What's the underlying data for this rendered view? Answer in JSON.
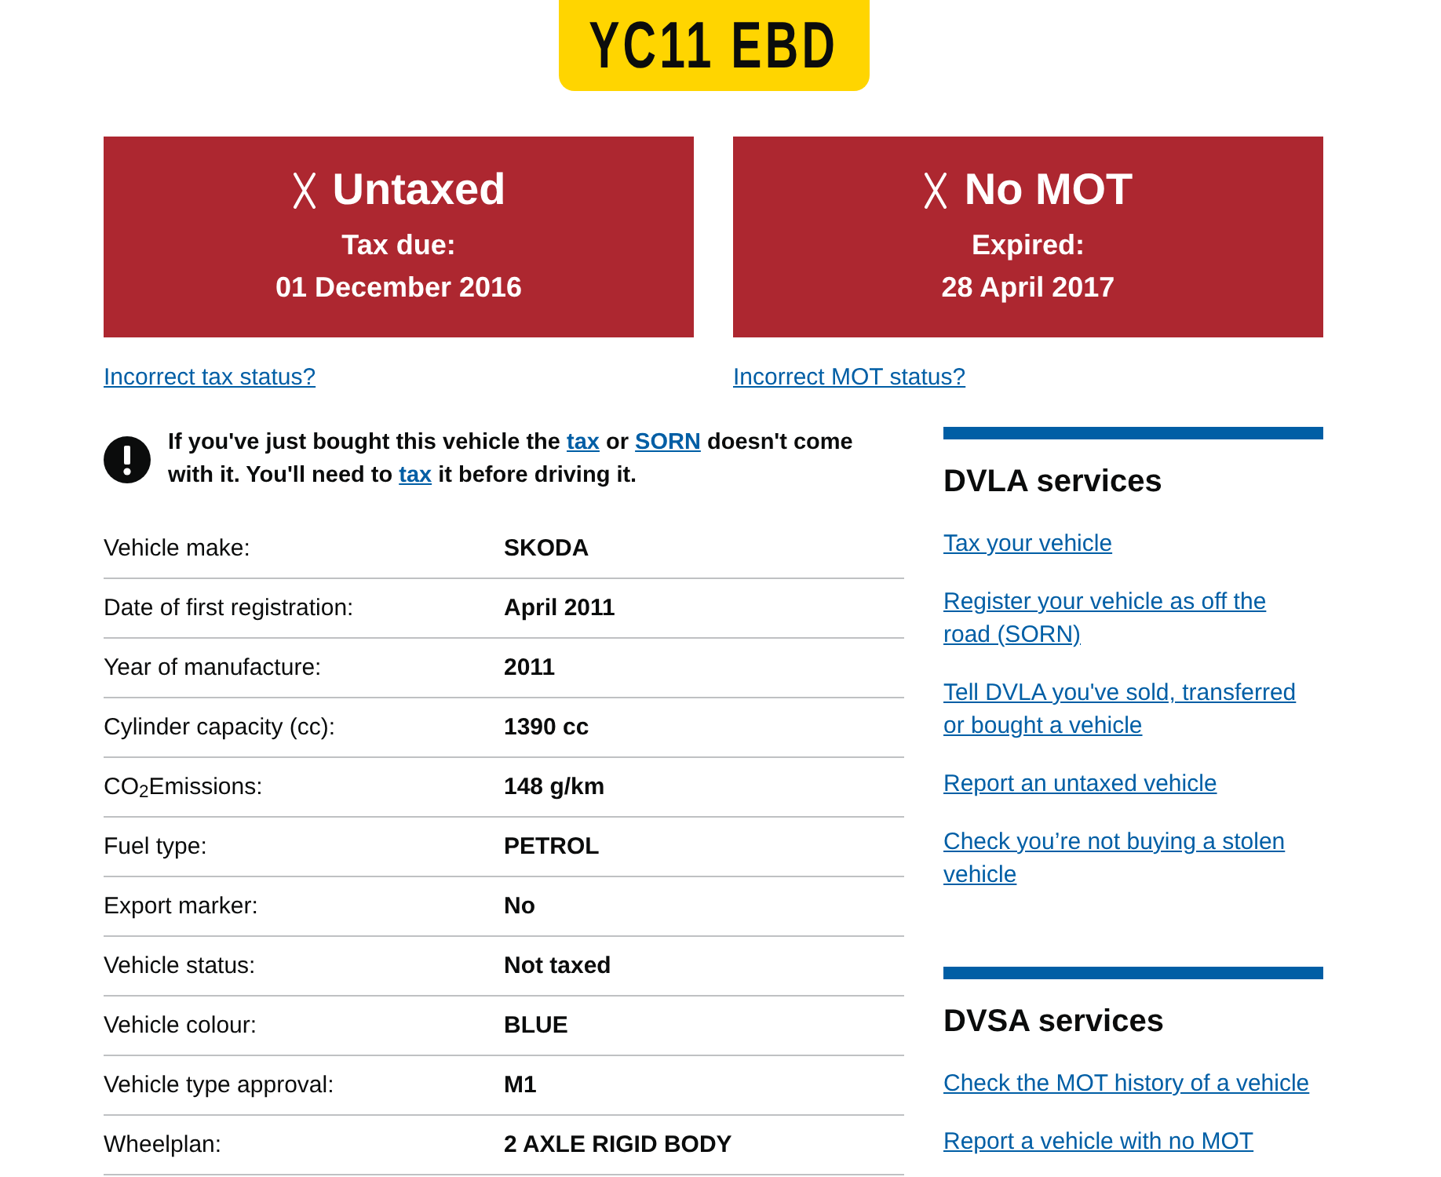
{
  "plate": {
    "registration": "YC11 EBD"
  },
  "status_panels": [
    {
      "valid": false,
      "title": "Untaxed",
      "label": "Tax due:",
      "date": "01 December 2016",
      "link": "Incorrect tax status?"
    },
    {
      "valid": false,
      "title": "No MOT",
      "label": "Expired:",
      "date": "28 April 2017",
      "link": "Incorrect MOT status?"
    }
  ],
  "warning": {
    "parts": [
      {
        "kind": "text",
        "text": "If you've just bought this vehicle the "
      },
      {
        "kind": "link",
        "text": "tax"
      },
      {
        "kind": "text",
        "text": " or "
      },
      {
        "kind": "link",
        "text": "SORN"
      },
      {
        "kind": "text",
        "text": " doesn't come with it. You'll need to "
      },
      {
        "kind": "link",
        "text": "tax"
      },
      {
        "kind": "text",
        "text": " it before driving it."
      }
    ]
  },
  "vehicle_details": [
    {
      "label": "Vehicle make:",
      "value": "SKODA"
    },
    {
      "label": "Date of first registration:",
      "value": "April 2011"
    },
    {
      "label": "Year of manufacture:",
      "value": "2011"
    },
    {
      "label": "Cylinder capacity (cc):",
      "value": "1390 cc"
    },
    {
      "label": "CO$_{2}$Emissions:",
      "value": "148 g/km"
    },
    {
      "label": "Fuel type:",
      "value": "PETROL"
    },
    {
      "label": "Export marker:",
      "value": "No"
    },
    {
      "label": "Vehicle status:",
      "value": "Not taxed"
    },
    {
      "label": "Vehicle colour:",
      "value": "BLUE"
    },
    {
      "label": "Vehicle type approval:",
      "value": "M1"
    },
    {
      "label": "Wheelplan:",
      "value": "2 AXLE RIGID BODY"
    }
  ],
  "sidebar": {
    "sections": [
      {
        "title": "DVLA services",
        "links": [
          "Tax your vehicle",
          "Register your vehicle as off the road (SORN)",
          "Tell DVLA you've sold, transferred or bought a vehicle",
          "Report an untaxed vehicle",
          "Check you’re not buying a stolen vehicle"
        ]
      },
      {
        "title": "DVSA services",
        "links": [
          "Check the MOT history of a vehicle",
          "Report a vehicle with no MOT"
        ]
      }
    ]
  }
}
